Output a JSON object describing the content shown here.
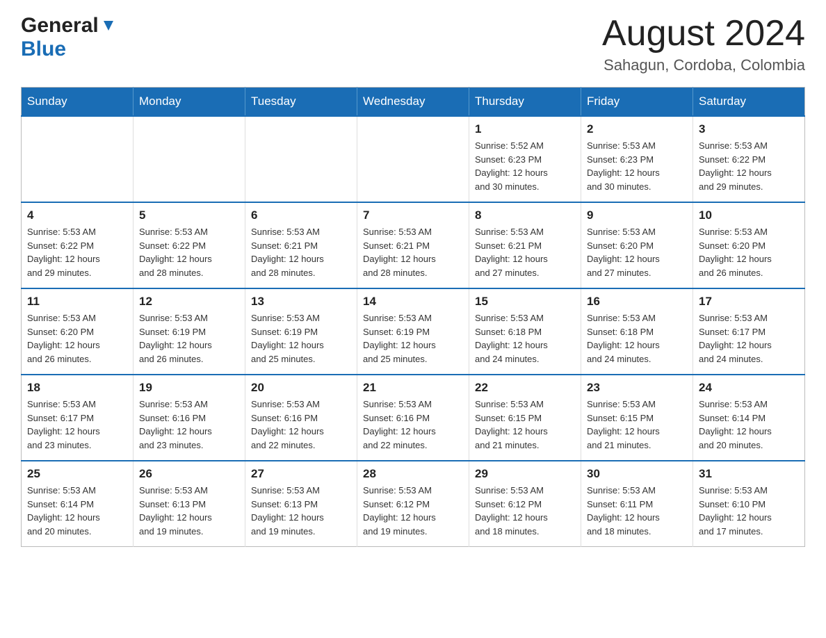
{
  "logo": {
    "general": "General",
    "blue": "Blue"
  },
  "header": {
    "month": "August 2024",
    "location": "Sahagun, Cordoba, Colombia"
  },
  "days_of_week": [
    "Sunday",
    "Monday",
    "Tuesday",
    "Wednesday",
    "Thursday",
    "Friday",
    "Saturday"
  ],
  "weeks": [
    [
      {
        "day": "",
        "info": ""
      },
      {
        "day": "",
        "info": ""
      },
      {
        "day": "",
        "info": ""
      },
      {
        "day": "",
        "info": ""
      },
      {
        "day": "1",
        "info": "Sunrise: 5:52 AM\nSunset: 6:23 PM\nDaylight: 12 hours\nand 30 minutes."
      },
      {
        "day": "2",
        "info": "Sunrise: 5:53 AM\nSunset: 6:23 PM\nDaylight: 12 hours\nand 30 minutes."
      },
      {
        "day": "3",
        "info": "Sunrise: 5:53 AM\nSunset: 6:22 PM\nDaylight: 12 hours\nand 29 minutes."
      }
    ],
    [
      {
        "day": "4",
        "info": "Sunrise: 5:53 AM\nSunset: 6:22 PM\nDaylight: 12 hours\nand 29 minutes."
      },
      {
        "day": "5",
        "info": "Sunrise: 5:53 AM\nSunset: 6:22 PM\nDaylight: 12 hours\nand 28 minutes."
      },
      {
        "day": "6",
        "info": "Sunrise: 5:53 AM\nSunset: 6:21 PM\nDaylight: 12 hours\nand 28 minutes."
      },
      {
        "day": "7",
        "info": "Sunrise: 5:53 AM\nSunset: 6:21 PM\nDaylight: 12 hours\nand 28 minutes."
      },
      {
        "day": "8",
        "info": "Sunrise: 5:53 AM\nSunset: 6:21 PM\nDaylight: 12 hours\nand 27 minutes."
      },
      {
        "day": "9",
        "info": "Sunrise: 5:53 AM\nSunset: 6:20 PM\nDaylight: 12 hours\nand 27 minutes."
      },
      {
        "day": "10",
        "info": "Sunrise: 5:53 AM\nSunset: 6:20 PM\nDaylight: 12 hours\nand 26 minutes."
      }
    ],
    [
      {
        "day": "11",
        "info": "Sunrise: 5:53 AM\nSunset: 6:20 PM\nDaylight: 12 hours\nand 26 minutes."
      },
      {
        "day": "12",
        "info": "Sunrise: 5:53 AM\nSunset: 6:19 PM\nDaylight: 12 hours\nand 26 minutes."
      },
      {
        "day": "13",
        "info": "Sunrise: 5:53 AM\nSunset: 6:19 PM\nDaylight: 12 hours\nand 25 minutes."
      },
      {
        "day": "14",
        "info": "Sunrise: 5:53 AM\nSunset: 6:19 PM\nDaylight: 12 hours\nand 25 minutes."
      },
      {
        "day": "15",
        "info": "Sunrise: 5:53 AM\nSunset: 6:18 PM\nDaylight: 12 hours\nand 24 minutes."
      },
      {
        "day": "16",
        "info": "Sunrise: 5:53 AM\nSunset: 6:18 PM\nDaylight: 12 hours\nand 24 minutes."
      },
      {
        "day": "17",
        "info": "Sunrise: 5:53 AM\nSunset: 6:17 PM\nDaylight: 12 hours\nand 24 minutes."
      }
    ],
    [
      {
        "day": "18",
        "info": "Sunrise: 5:53 AM\nSunset: 6:17 PM\nDaylight: 12 hours\nand 23 minutes."
      },
      {
        "day": "19",
        "info": "Sunrise: 5:53 AM\nSunset: 6:16 PM\nDaylight: 12 hours\nand 23 minutes."
      },
      {
        "day": "20",
        "info": "Sunrise: 5:53 AM\nSunset: 6:16 PM\nDaylight: 12 hours\nand 22 minutes."
      },
      {
        "day": "21",
        "info": "Sunrise: 5:53 AM\nSunset: 6:16 PM\nDaylight: 12 hours\nand 22 minutes."
      },
      {
        "day": "22",
        "info": "Sunrise: 5:53 AM\nSunset: 6:15 PM\nDaylight: 12 hours\nand 21 minutes."
      },
      {
        "day": "23",
        "info": "Sunrise: 5:53 AM\nSunset: 6:15 PM\nDaylight: 12 hours\nand 21 minutes."
      },
      {
        "day": "24",
        "info": "Sunrise: 5:53 AM\nSunset: 6:14 PM\nDaylight: 12 hours\nand 20 minutes."
      }
    ],
    [
      {
        "day": "25",
        "info": "Sunrise: 5:53 AM\nSunset: 6:14 PM\nDaylight: 12 hours\nand 20 minutes."
      },
      {
        "day": "26",
        "info": "Sunrise: 5:53 AM\nSunset: 6:13 PM\nDaylight: 12 hours\nand 19 minutes."
      },
      {
        "day": "27",
        "info": "Sunrise: 5:53 AM\nSunset: 6:13 PM\nDaylight: 12 hours\nand 19 minutes."
      },
      {
        "day": "28",
        "info": "Sunrise: 5:53 AM\nSunset: 6:12 PM\nDaylight: 12 hours\nand 19 minutes."
      },
      {
        "day": "29",
        "info": "Sunrise: 5:53 AM\nSunset: 6:12 PM\nDaylight: 12 hours\nand 18 minutes."
      },
      {
        "day": "30",
        "info": "Sunrise: 5:53 AM\nSunset: 6:11 PM\nDaylight: 12 hours\nand 18 minutes."
      },
      {
        "day": "31",
        "info": "Sunrise: 5:53 AM\nSunset: 6:10 PM\nDaylight: 12 hours\nand 17 minutes."
      }
    ]
  ]
}
